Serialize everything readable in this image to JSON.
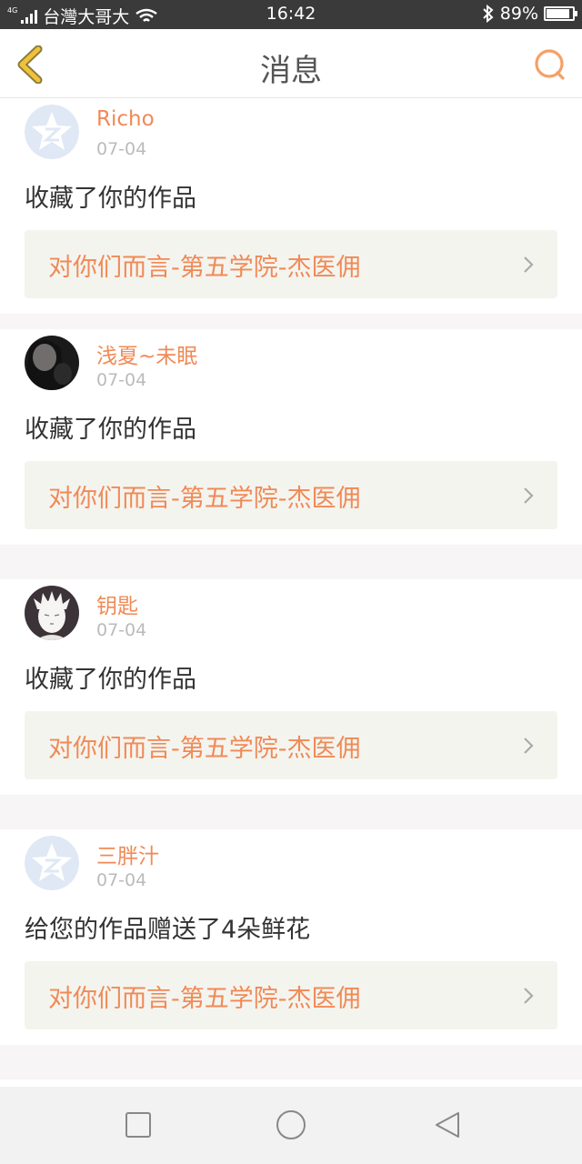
{
  "status_bar": {
    "network_label": "4G",
    "carrier": "台灣大哥大",
    "time": "16:42",
    "battery": "89%",
    "battery_level": 0.89,
    "icons": [
      "signal-icon",
      "wifi-icon",
      "bluetooth-icon",
      "battery-icon"
    ]
  },
  "header": {
    "title": "消息",
    "back_icon": "chevron-left-icon",
    "search_icon": "search-icon"
  },
  "messages": [
    {
      "name": "Richo",
      "date": "07-04",
      "action": "收藏了你的作品",
      "work": "对你们而言-第五学院-杰医佣",
      "avatar": "qzone-default-avatar"
    },
    {
      "name": "浅夏~未眠",
      "date": "07-04",
      "action": "收藏了你的作品",
      "work": "对你们而言-第五学院-杰医佣",
      "avatar": "photo-avatar-dark"
    },
    {
      "name": "钥匙",
      "date": "07-04",
      "action": "收藏了你的作品",
      "work": "对你们而言-第五学院-杰医佣",
      "avatar": "illustration-avatar"
    },
    {
      "name": "三胖汁",
      "date": "07-04",
      "action": "给您的作品赠送了4朵鲜花",
      "work": "对你们而言-第五学院-杰医佣",
      "avatar": "qzone-default-avatar"
    }
  ],
  "nav_bar": {
    "buttons": [
      "square-recent-apps-icon",
      "circle-home-icon",
      "triangle-back-icon"
    ]
  },
  "colors": {
    "accent": "#f08a56",
    "back_arrow": "#f0c23a",
    "link_background": "#f4f4ef",
    "status_bar": "#3a3a3a"
  }
}
